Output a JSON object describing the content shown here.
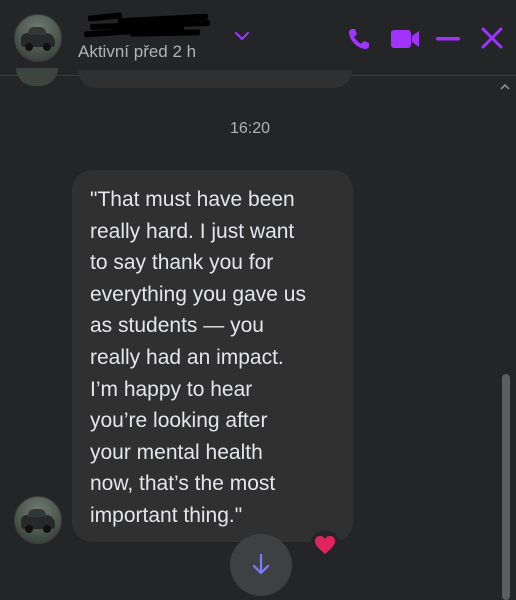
{
  "header": {
    "status": "Aktivní před 2 h",
    "icons": [
      "avatar",
      "chevron-down-icon",
      "phone-icon",
      "video-icon",
      "minimize-icon",
      "close-icon"
    ],
    "accent": "#a033ff"
  },
  "conversation": {
    "timestamp": "16:20",
    "message": {
      "text": "\"That must have been\nreally hard. I just want\nto say thank you for\neverything you gave us\nas students — you\nreally had an impact.\nI’m happy to hear\nyou’re looking after\nyour mental health\nnow, that’s the most\nimportant thing.\"",
      "reaction": "❤️"
    }
  },
  "colors": {
    "background": "#242526",
    "bubble": "#303030",
    "text": "#e4e6eb",
    "muted": "#b0b3b8",
    "jump_button": "#3e4042",
    "jump_arrow": "#7b7bff"
  }
}
